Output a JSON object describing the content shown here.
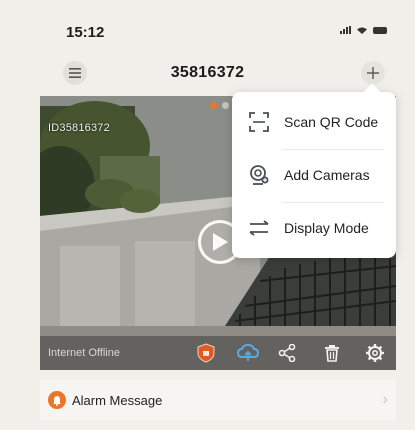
{
  "status_bar": {
    "time": "15:12"
  },
  "nav": {
    "title": "35816372"
  },
  "camera": {
    "id_label": "ID35816372",
    "status_text": "Internet Offline"
  },
  "popup_menu": {
    "items": [
      {
        "label": "Scan QR Code",
        "icon": "scan-qr-icon"
      },
      {
        "label": "Add Cameras",
        "icon": "add-camera-icon"
      },
      {
        "label": "Display Mode",
        "icon": "display-mode-icon"
      }
    ]
  },
  "alarm": {
    "label": "Alarm Message",
    "icon": "alarm-bell-icon"
  },
  "colors": {
    "accent": "#e8782c",
    "background": "#f1efea"
  }
}
